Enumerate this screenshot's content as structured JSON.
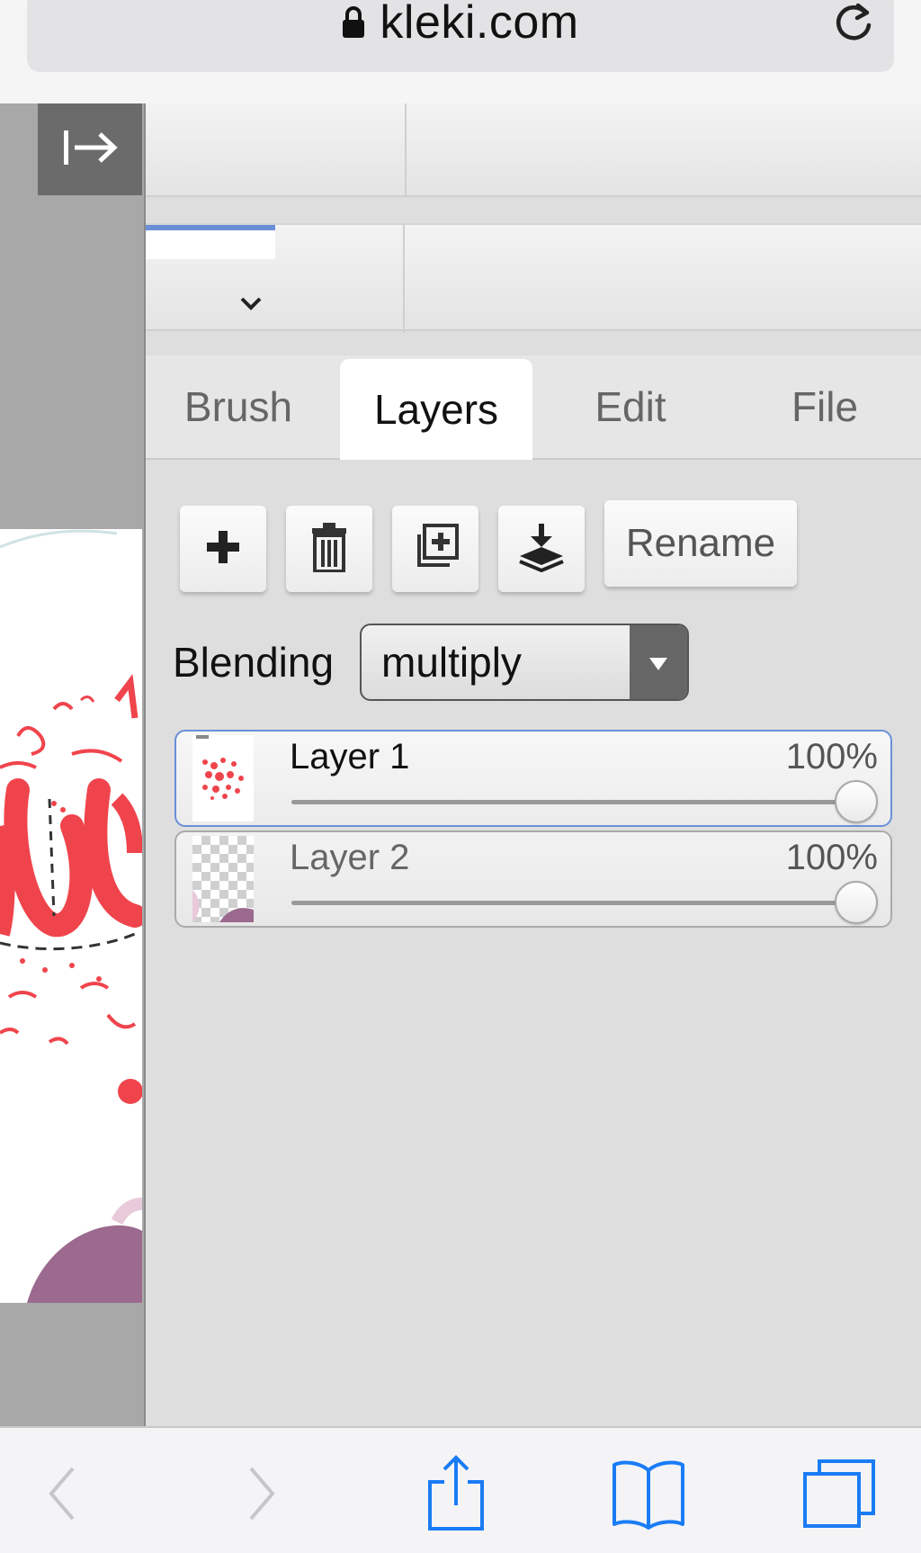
{
  "browser": {
    "url": "kleki.com",
    "lock_icon": "lock-icon",
    "reload_icon": "reload-icon"
  },
  "sidebar": {
    "collapse_icon": "collapse-panel-icon"
  },
  "tabs": [
    {
      "label": "Brush",
      "active": false
    },
    {
      "label": "Layers",
      "active": true
    },
    {
      "label": "Edit",
      "active": false
    },
    {
      "label": "File",
      "active": false
    }
  ],
  "layer_tools": {
    "add_icon": "plus-icon",
    "delete_icon": "trash-icon",
    "duplicate_icon": "duplicate-icon",
    "merge_icon": "merge-down-icon",
    "rename_label": "Rename"
  },
  "blending": {
    "label": "Blending",
    "value": "multiply"
  },
  "layers": [
    {
      "name": "Layer 1",
      "opacity": "100%",
      "opacity_value": 1.0,
      "selected": true
    },
    {
      "name": "Layer 2",
      "opacity": "100%",
      "opacity_value": 1.0,
      "selected": false
    }
  ],
  "bottom_toolbar": {
    "back_icon": "back-icon",
    "forward_icon": "forward-icon",
    "share_icon": "share-icon",
    "bookmarks_icon": "bookmarks-icon",
    "tabs_icon": "tabs-icon"
  },
  "colors": {
    "accent": "#6a8fd8",
    "safari_blue": "#1a7cf5",
    "panel_bg": "#dedede",
    "artwork_red": "#f0444c"
  }
}
